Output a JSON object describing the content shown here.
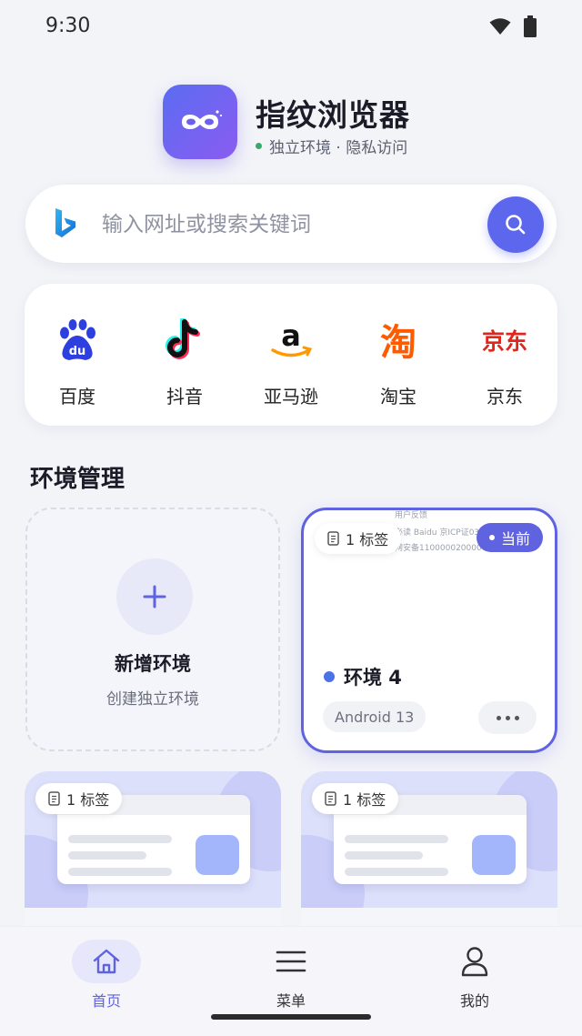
{
  "status_bar": {
    "time": "9:30"
  },
  "app": {
    "title": "指纹浏览器",
    "subtitle": "独立环境 · 隐私访问"
  },
  "search": {
    "placeholder": "输入网址或搜索关键词",
    "value": ""
  },
  "shortcuts": [
    {
      "label": "百度",
      "icon": "baidu-icon"
    },
    {
      "label": "抖音",
      "icon": "douyin-icon"
    },
    {
      "label": "亚马逊",
      "icon": "amazon-icon"
    },
    {
      "label": "淘宝",
      "icon": "taobao-icon"
    },
    {
      "label": "京东",
      "icon": "jd-icon"
    }
  ],
  "section": {
    "title": "环境管理"
  },
  "new_env": {
    "title": "新增环境",
    "subtitle": "创建独立环境"
  },
  "current_env": {
    "tab_count": "1 标签",
    "badge": "当前",
    "name": "环境 4",
    "os": "Android 13",
    "ghost_lines": [
      "用户反馈",
      "必读 Baidu 京ICP证030",
      "网安备110000020000"
    ]
  },
  "env_previews": [
    {
      "tab_count": "1 标签"
    },
    {
      "tab_count": "1 标签"
    }
  ],
  "bottom_nav": {
    "home": "首页",
    "menu": "菜单",
    "profile": "我的"
  },
  "colors": {
    "accent": "#5d67ee",
    "current_border": "#5f63e0",
    "online_dot": "#3aa76d"
  }
}
